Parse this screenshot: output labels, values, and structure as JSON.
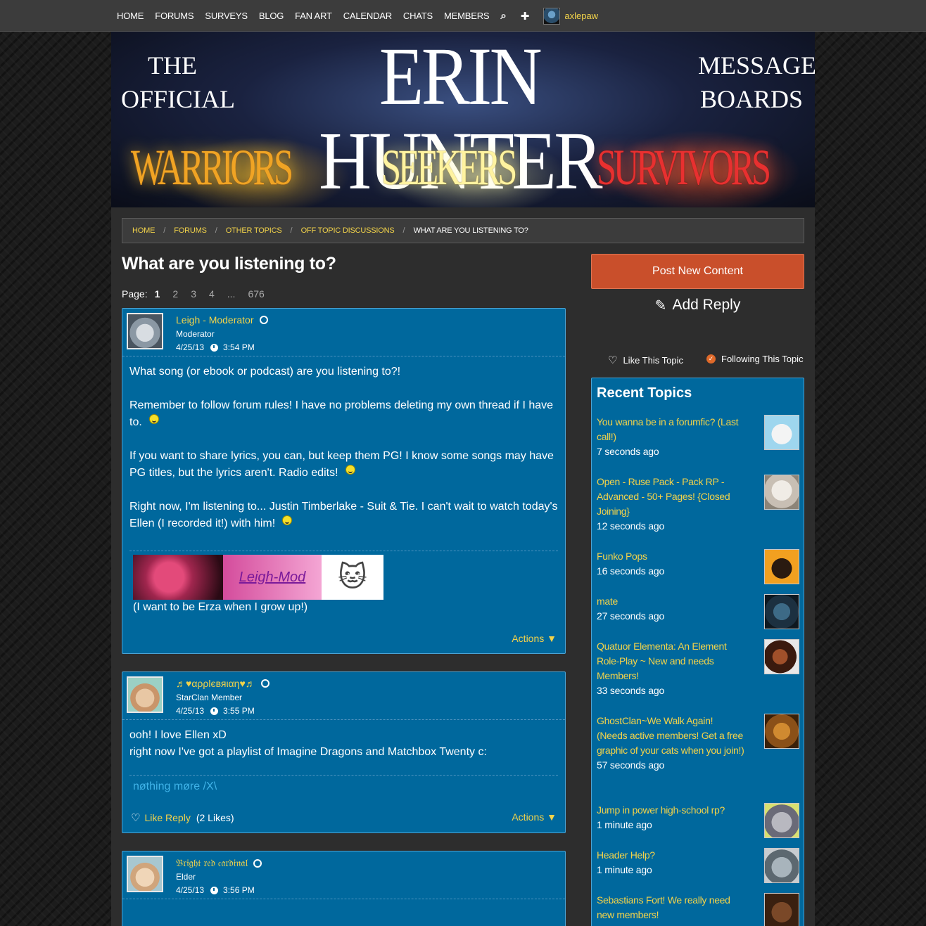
{
  "nav": {
    "items": [
      "HOME",
      "FORUMS",
      "SURVEYS",
      "BLOG",
      "FAN ART",
      "CALENDAR",
      "CHATS",
      "MEMBERS"
    ],
    "search_icon": "search-icon",
    "plus_icon": "plus-icon",
    "username": "axlepaw"
  },
  "banner": {
    "the": "THE",
    "official": "OFFICIAL",
    "title": "ERIN  HUNTER",
    "message": "MESSAGE",
    "boards": "BOARDS",
    "series1": "WARRIORS",
    "series2": "SEEKERS",
    "series3": "SURVIVORS"
  },
  "breadcrumb": {
    "home": "HOME",
    "forums": "FORUMS",
    "other": "OTHER TOPICS",
    "offtopic": "OFF TOPIC DISCUSSIONS",
    "current": "WHAT ARE YOU LISTENING TO?"
  },
  "topic": {
    "title": "What are you listening to?",
    "page_label": "Page:",
    "pages": [
      "1",
      "2",
      "3",
      "4",
      "...",
      "676"
    ]
  },
  "posts": [
    {
      "username": "Leigh - Moderator",
      "role": "Moderator",
      "date": "4/25/13",
      "time": "3:54 PM",
      "paragraphs": [
        "What song (or ebook or podcast) are you listening to?!",
        "Remember to follow forum rules! I have no problems deleting my own thread if I have to.",
        "If you want to share lyrics, you can, but keep them PG! I know some songs may have PG titles, but the lyrics aren't. Radio edits!",
        "Right now, I'm listening to... Justin Timberlake - Suit & Tie. I can't wait to watch today's Ellen (I recorded it!) with him!"
      ],
      "sig_image_text": "Leigh-Mod",
      "signature": "(I want to be Erza when I grow up!)",
      "actions": "Actions ▼"
    },
    {
      "username": "♬♥αρρlєвяιαη♥♬",
      "role": "StarClan Member",
      "date": "4/25/13",
      "time": "3:55 PM",
      "line1": "ooh! I love Ellen xD",
      "line2": "right now I've got a playlist of Imagine Dragons and Matchbox Twenty c:",
      "signature": "nøthing møre /X\\",
      "like": "Like Reply",
      "likes": "(2 Likes)",
      "actions": "Actions ▼"
    },
    {
      "username": "𝔅𝔯𝔦𝔤𝔥𝔱 𝔯𝔢𝔡 𝔠𝔞𝔯𝔡𝔦𝔫𝔞𝔩",
      "role": "Elder",
      "date": "4/25/13",
      "time": "3:56 PM"
    }
  ],
  "sidebar": {
    "post_new": "Post New Content",
    "add_reply": "Add Reply",
    "like_topic": "Like This Topic",
    "following_topic": "Following This Topic",
    "recent_title": "Recent Topics",
    "recent": [
      {
        "title": "You wanna be in a forumfic? (Last call!)",
        "ago": "7 seconds ago"
      },
      {
        "title": "Open - Ruse Pack - Pack RP - Advanced - 50+ Pages! {Closed Joining}",
        "ago": "12 seconds ago"
      },
      {
        "title": "Funko Pops",
        "ago": "16 seconds ago"
      },
      {
        "title": "mate",
        "ago": "27 seconds ago"
      },
      {
        "title": "Quatuor Elementa: An Element Role-Play ~ New and needs Members!",
        "ago": "33 seconds ago"
      },
      {
        "title": "GhostClan~We Walk Again! (Needs active members! Get a free graphic of your cats when you join!)",
        "ago": "57 seconds ago"
      },
      {
        "title": "Jump in power high-school rp?",
        "ago": "1 minute ago"
      },
      {
        "title": "Header Help?",
        "ago": "1 minute ago"
      },
      {
        "title": "Sebastians Fort! We really need new members!",
        "ago": ""
      }
    ]
  },
  "colors": {
    "accent": "#f2d34a",
    "post_bg": "#00689d",
    "button": "#c94f2b",
    "nav_bg": "#3c3c3c"
  }
}
